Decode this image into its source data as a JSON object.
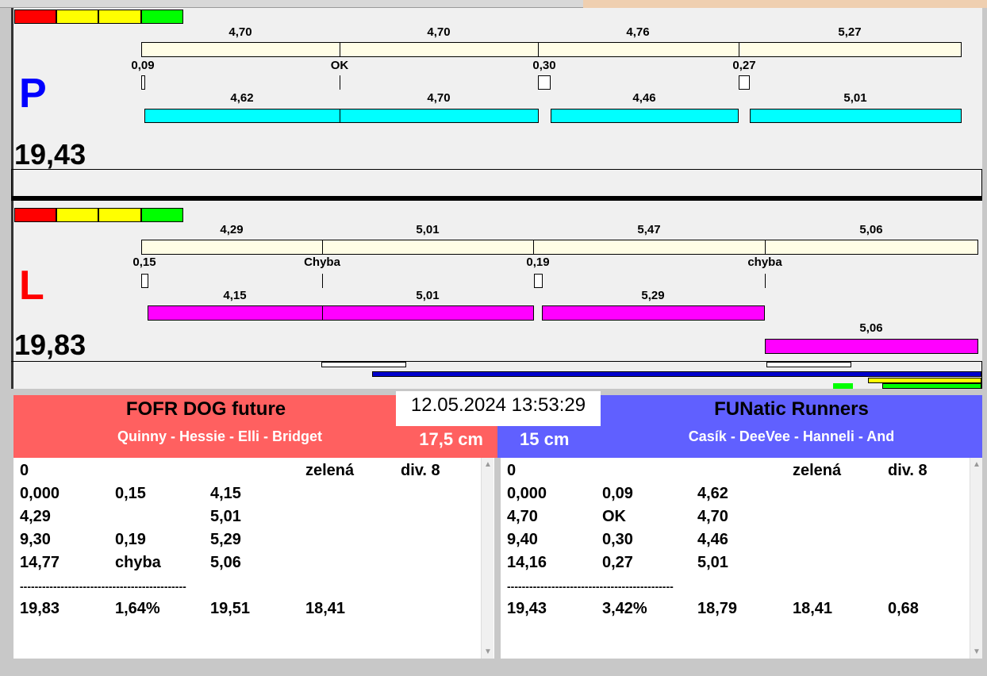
{
  "colors": {
    "red": "#ff0000",
    "yellow": "#ffff00",
    "green": "#00ff00",
    "left_team": "#ff6060",
    "right_team": "#6060ff"
  },
  "P": {
    "letter": "P",
    "total": "19,43",
    "top_labels": [
      "4,70",
      "4,70",
      "4,76",
      "5,27"
    ],
    "change_labels": [
      "0,09",
      "OK",
      "0,30",
      "0,27"
    ],
    "run_labels": [
      "4,62",
      "4,70",
      "4,46",
      "5,01"
    ]
  },
  "L": {
    "letter": "L",
    "total": "19,83",
    "top_labels": [
      "4,29",
      "5,01",
      "5,47",
      "5,06"
    ],
    "change_labels": [
      "0,15",
      "Chyba",
      "0,19",
      "chyba"
    ],
    "run_labels": [
      "4,15",
      "5,01",
      "5,29",
      "5,06"
    ]
  },
  "datetime": "12.05.2024 13:53:29",
  "left_team": {
    "name": "FOFR DOG future",
    "dogs": "Quinny - Hessie - Elli - Bridget",
    "height": "17,5 cm",
    "rows": [
      [
        "0",
        "",
        "",
        "zelená",
        "div. 8"
      ],
      [
        "0,000",
        "0,15",
        "4,15",
        "",
        ""
      ],
      [
        "4,29",
        "",
        "5,01",
        "",
        ""
      ],
      [
        "9,30",
        "0,19",
        "5,29",
        "",
        ""
      ],
      [
        "14,77",
        "chyba",
        "5,06",
        "",
        ""
      ],
      [
        "---------------------------------------------",
        "",
        "",
        "",
        ""
      ],
      [
        "19,83",
        "1,64%",
        "19,51",
        "18,41",
        ""
      ]
    ]
  },
  "right_team": {
    "name": "FUNatic Runners",
    "dogs": "Casík - DeeVee - Hanneli - And",
    "height": "15 cm",
    "rows": [
      [
        "0",
        "",
        "",
        "zelená",
        "div. 8"
      ],
      [
        "0,000",
        "0,09",
        "4,62",
        "",
        ""
      ],
      [
        "4,70",
        "OK",
        "4,70",
        "",
        ""
      ],
      [
        "9,40",
        "0,30",
        "4,46",
        "",
        ""
      ],
      [
        "14,16",
        "0,27",
        "5,01",
        "",
        ""
      ],
      [
        "---------------------------------------------",
        "",
        "",
        "",
        ""
      ],
      [
        "19,43",
        "3,42%",
        "18,79",
        "18,41",
        "0,68"
      ]
    ]
  }
}
